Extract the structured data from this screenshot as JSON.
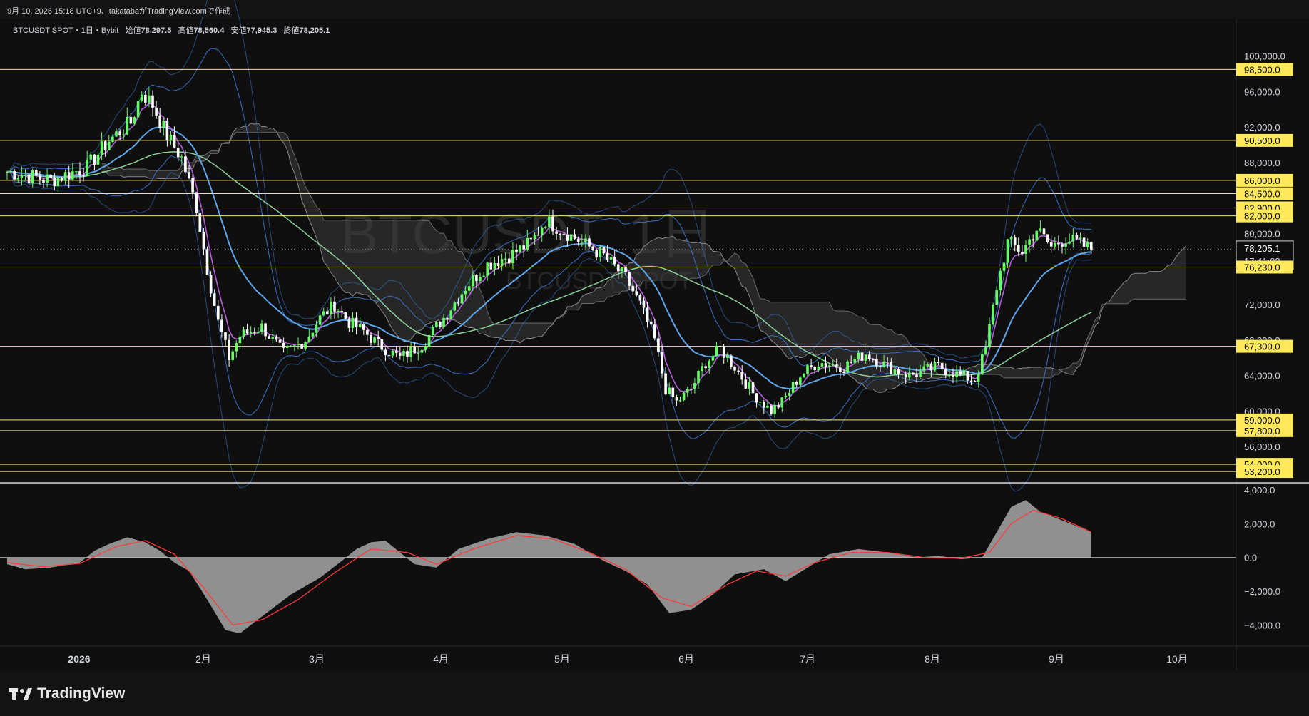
{
  "header": {
    "caption": "9月 10, 2026 15:18 UTC+9、takatabaがTradingView.comで作成"
  },
  "legend": {
    "symbol": "BTCUSDT SPOT・1日・Bybit",
    "open_label": "始値",
    "open": "78,297.5",
    "high_label": "高値",
    "high": "78,560.4",
    "low_label": "安値",
    "low": "77,945.3",
    "close_label": "終値",
    "close": "78,205.1"
  },
  "watermark": {
    "line1": "BTCUSDT, 1日",
    "line2": "BTCUSDT SPOT"
  },
  "brand": {
    "name": "TradingView",
    "icon": "tradingview-logo-icon"
  },
  "colors": {
    "background": "#0f0f0f",
    "level_line": "#f7e27b",
    "level_badge": "#ffe85a",
    "candle_up": "#66ff66",
    "candle_down": "#ffffff",
    "bollinger": "#3d7bd8",
    "ma_fast": "#b45fd6",
    "ma_mid": "#5ea6ea",
    "ma_slow": "#8ad09a",
    "cloud": "#3c3c3c",
    "macd_hist": "#9e9e9e",
    "macd_signal": "#ff3b3b",
    "last_price": "#ffffff"
  },
  "chart_data": [
    {
      "type": "candlestick",
      "title": "BTCUSDT SPOT・1日・Bybit",
      "x_axis": {
        "ticks": [
          "2026",
          "2月",
          "3月",
          "4月",
          "5月",
          "6月",
          "7月",
          "8月",
          "9月",
          "10月"
        ]
      },
      "y_axis": {
        "ticks": [
          "100,000.0",
          "96,000.0",
          "92,000.0",
          "88,000.0",
          "80,000.0",
          "72,000.0",
          "68,000.0",
          "64,000.0",
          "60,000.0",
          "56,000.0"
        ],
        "range": [
          52000,
          101500
        ]
      },
      "horizontal_levels": [
        {
          "value": 98500,
          "label": "98,500.0"
        },
        {
          "value": 90500,
          "label": "90,500.0"
        },
        {
          "value": 86000,
          "label": "86,000.0"
        },
        {
          "value": 84500,
          "label": "84,500.0"
        },
        {
          "value": 82900,
          "label": "82,900.0"
        },
        {
          "value": 82000,
          "label": "82,000.0"
        },
        {
          "value": 76230,
          "label": "76,230.0"
        },
        {
          "value": 67300,
          "label": "67,300.0"
        },
        {
          "value": 59000,
          "label": "59,000.0"
        },
        {
          "value": 57800,
          "label": "57,800.0"
        },
        {
          "value": 54000,
          "label": "54,000.0"
        },
        {
          "value": 53200,
          "label": "53,200.0"
        }
      ],
      "last_price": {
        "value": 78205.1,
        "label": "78,205.1",
        "countdown": "17:41:03"
      },
      "price_path": [
        [
          0,
          87000
        ],
        [
          12,
          86000
        ],
        [
          22,
          87500
        ],
        [
          28,
          90500
        ],
        [
          34,
          92500
        ],
        [
          37,
          96000
        ],
        [
          40,
          94500
        ],
        [
          44,
          91000
        ],
        [
          48,
          88500
        ],
        [
          52,
          83000
        ],
        [
          55,
          76000
        ],
        [
          58,
          70000
        ],
        [
          61,
          66000
        ],
        [
          64,
          68500
        ],
        [
          70,
          69500
        ],
        [
          76,
          66500
        ],
        [
          82,
          68000
        ],
        [
          86,
          70500
        ],
        [
          90,
          72000
        ],
        [
          94,
          70000
        ],
        [
          98,
          69000
        ],
        [
          102,
          67500
        ],
        [
          108,
          66000
        ],
        [
          114,
          67500
        ],
        [
          120,
          70500
        ],
        [
          126,
          74000
        ],
        [
          132,
          76500
        ],
        [
          138,
          77500
        ],
        [
          144,
          79000
        ],
        [
          148,
          81500
        ],
        [
          152,
          80500
        ],
        [
          158,
          79000
        ],
        [
          164,
          77500
        ],
        [
          170,
          75000
        ],
        [
          174,
          72000
        ],
        [
          178,
          68000
        ],
        [
          181,
          62500
        ],
        [
          184,
          61000
        ],
        [
          188,
          62500
        ],
        [
          192,
          65500
        ],
        [
          196,
          67000
        ],
        [
          200,
          65000
        ],
        [
          205,
          62000
        ],
        [
          210,
          60000
        ],
        [
          213,
          61000
        ],
        [
          218,
          64000
        ],
        [
          223,
          65500
        ],
        [
          230,
          65000
        ],
        [
          236,
          66500
        ],
        [
          242,
          65000
        ],
        [
          248,
          64000
        ],
        [
          256,
          65000
        ],
        [
          262,
          64000
        ],
        [
          266,
          63500
        ],
        [
          269,
          67000
        ],
        [
          272,
          74000
        ],
        [
          275,
          79000
        ],
        [
          279,
          78000
        ],
        [
          283,
          80500
        ],
        [
          287,
          78500
        ],
        [
          291,
          79500
        ],
        [
          295,
          78800
        ],
        [
          298,
          78205
        ]
      ],
      "indicators": [
        "Bollinger Bands",
        "Ichimoku cloud",
        "Moving averages (3)"
      ]
    },
    {
      "type": "area",
      "title": "MACD",
      "y_axis": {
        "ticks": [
          "4,000.0",
          "2,000.0",
          "0.0",
          "−2,000.0",
          "−4,000.0"
        ],
        "range": [
          -5000,
          4300
        ]
      },
      "histogram": [
        [
          0,
          -400
        ],
        [
          5,
          -700
        ],
        [
          12,
          -600
        ],
        [
          20,
          -300
        ],
        [
          24,
          400
        ],
        [
          28,
          800
        ],
        [
          33,
          1200
        ],
        [
          38,
          900
        ],
        [
          42,
          400
        ],
        [
          46,
          -300
        ],
        [
          50,
          -800
        ],
        [
          55,
          -2500
        ],
        [
          60,
          -4300
        ],
        [
          64,
          -4500
        ],
        [
          70,
          -3500
        ],
        [
          78,
          -2200
        ],
        [
          86,
          -1200
        ],
        [
          92,
          -200
        ],
        [
          96,
          500
        ],
        [
          100,
          900
        ],
        [
          104,
          1000
        ],
        [
          108,
          300
        ],
        [
          112,
          -400
        ],
        [
          118,
          -600
        ],
        [
          124,
          500
        ],
        [
          132,
          1100
        ],
        [
          140,
          1500
        ],
        [
          148,
          1300
        ],
        [
          156,
          800
        ],
        [
          164,
          -200
        ],
        [
          170,
          -800
        ],
        [
          176,
          -1600
        ],
        [
          182,
          -3300
        ],
        [
          188,
          -3100
        ],
        [
          194,
          -2200
        ],
        [
          200,
          -1000
        ],
        [
          208,
          -700
        ],
        [
          214,
          -1400
        ],
        [
          220,
          -600
        ],
        [
          226,
          200
        ],
        [
          234,
          500
        ],
        [
          242,
          300
        ],
        [
          250,
          0
        ],
        [
          256,
          100
        ],
        [
          262,
          -100
        ],
        [
          268,
          0
        ],
        [
          272,
          1500
        ],
        [
          276,
          3000
        ],
        [
          280,
          3400
        ],
        [
          284,
          2700
        ],
        [
          290,
          2200
        ],
        [
          298,
          1500
        ]
      ],
      "signal": [
        [
          0,
          -300
        ],
        [
          10,
          -550
        ],
        [
          20,
          -350
        ],
        [
          30,
          650
        ],
        [
          38,
          1000
        ],
        [
          46,
          200
        ],
        [
          54,
          -1800
        ],
        [
          62,
          -4000
        ],
        [
          70,
          -3700
        ],
        [
          80,
          -2500
        ],
        [
          90,
          -900
        ],
        [
          100,
          500
        ],
        [
          110,
          300
        ],
        [
          118,
          -400
        ],
        [
          128,
          500
        ],
        [
          140,
          1300
        ],
        [
          150,
          1100
        ],
        [
          160,
          300
        ],
        [
          170,
          -700
        ],
        [
          180,
          -2400
        ],
        [
          188,
          -2900
        ],
        [
          198,
          -1600
        ],
        [
          206,
          -800
        ],
        [
          214,
          -1100
        ],
        [
          222,
          -300
        ],
        [
          232,
          300
        ],
        [
          242,
          300
        ],
        [
          252,
          0
        ],
        [
          262,
          -50
        ],
        [
          270,
          300
        ],
        [
          276,
          2000
        ],
        [
          282,
          2800
        ],
        [
          290,
          2300
        ],
        [
          298,
          1500
        ]
      ]
    }
  ]
}
